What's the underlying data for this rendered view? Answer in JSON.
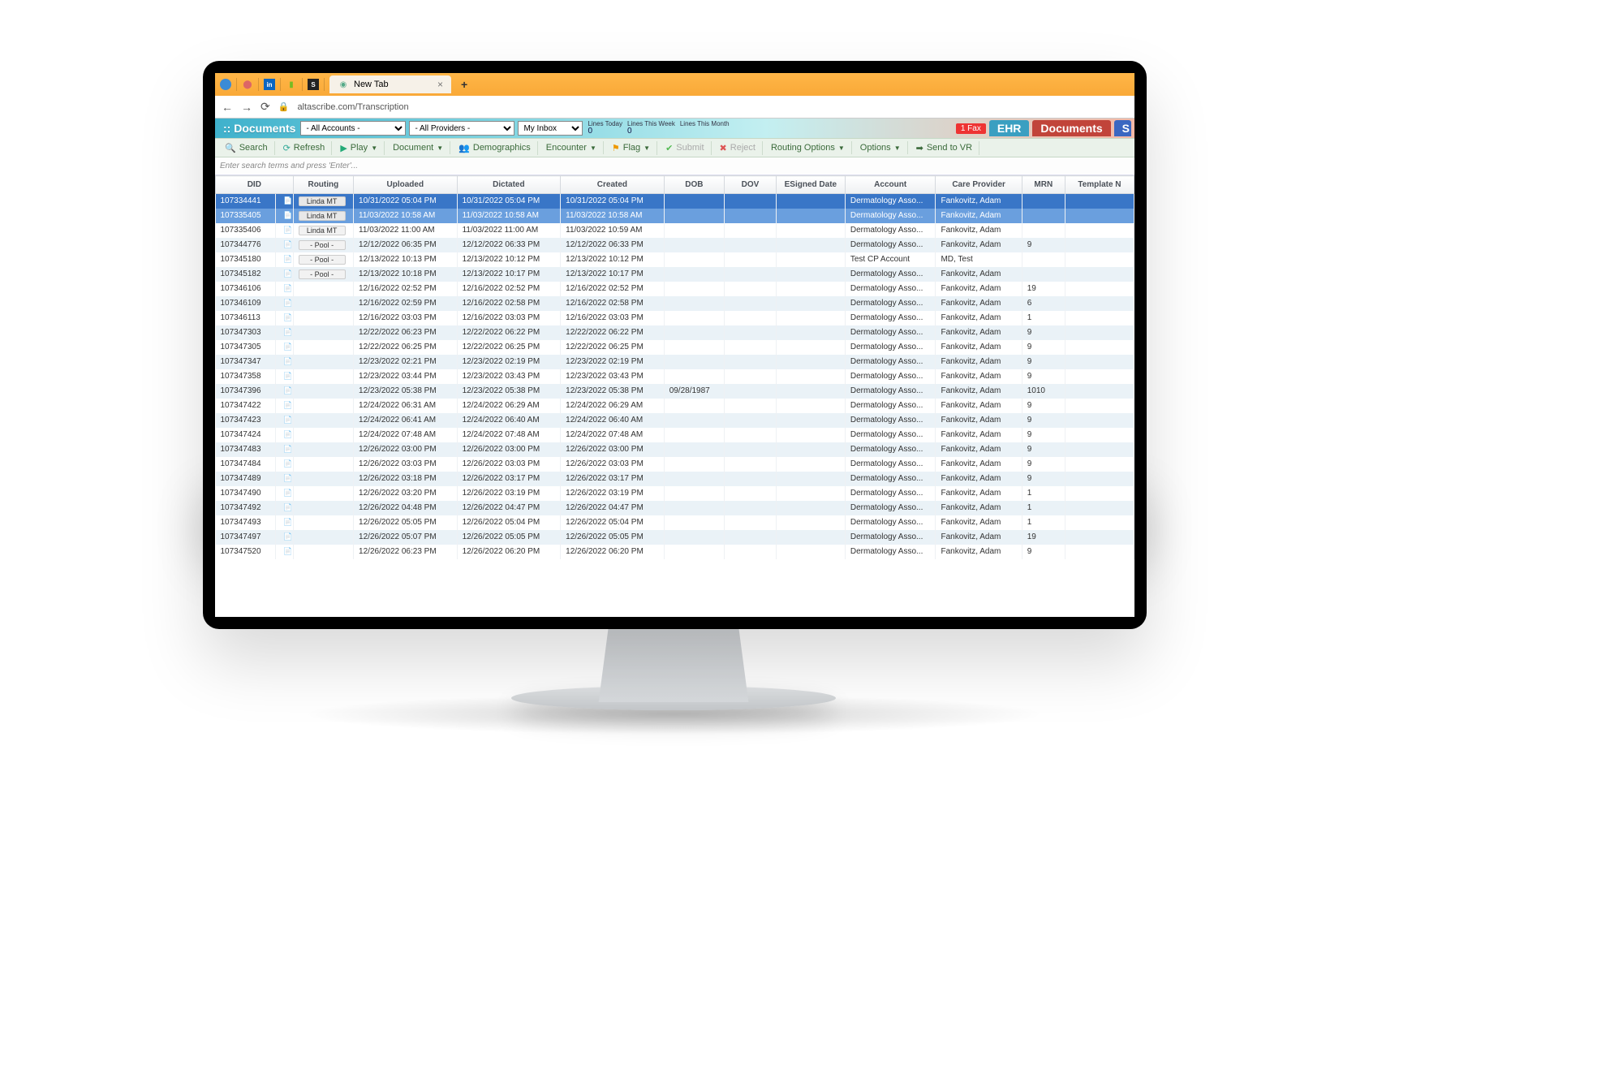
{
  "browser": {
    "tab_label": "New Tab",
    "plus": "+",
    "close": "×",
    "back": "←",
    "forward": "→",
    "reload": "⟳",
    "secure_icon": "🔒",
    "url": "altascribe.com/Transcription"
  },
  "header": {
    "app_title": ":: Documents",
    "accounts_select": "- All Accounts -",
    "providers_select": "- All Providers -",
    "inbox_select": "My Inbox",
    "lines_today_label": "Lines Today",
    "lines_today_value": "0",
    "lines_week_label": "Lines This Week",
    "lines_week_value": "0",
    "lines_month_label": "Lines This Month",
    "lines_month_value": "",
    "fax_badge": "1 Fax",
    "tab_ehr": "EHR",
    "tab_documents": "Documents",
    "tab_s": "S"
  },
  "toolbar": {
    "search": "Search",
    "refresh": "Refresh",
    "play": "Play",
    "document": "Document",
    "demographics": "Demographics",
    "encounter": "Encounter",
    "flag": "Flag",
    "submit": "Submit",
    "reject": "Reject",
    "routing_options": "Routing Options",
    "options": "Options",
    "send_to_vr": "Send to VR",
    "search_placeholder": "Enter search terms and press 'Enter'..."
  },
  "columns": {
    "did": "DID",
    "routing": "Routing",
    "uploaded": "Uploaded",
    "dictated": "Dictated",
    "created": "Created",
    "dob": "DOB",
    "dov": "DOV",
    "esigned": "ESigned Date",
    "account": "Account",
    "care_provider": "Care Provider",
    "mrn": "MRN",
    "template": "Template N"
  },
  "rows": [
    {
      "did": "107334441",
      "routing": "Linda MT",
      "uploaded": "10/31/2022 05:04 PM",
      "dictated": "10/31/2022 05:04 PM",
      "created": "10/31/2022 05:04 PM",
      "dob": "",
      "dov": "",
      "esigned": "",
      "account": "Dermatology Asso...",
      "provider": "Fankovitz, Adam",
      "mrn": "",
      "template": "",
      "sel": "1"
    },
    {
      "did": "107335405",
      "routing": "Linda MT",
      "uploaded": "11/03/2022 10:58 AM",
      "dictated": "11/03/2022 10:58 AM",
      "created": "11/03/2022 10:58 AM",
      "dob": "",
      "dov": "",
      "esigned": "",
      "account": "Dermatology Asso...",
      "provider": "Fankovitz, Adam",
      "mrn": "",
      "template": "",
      "sel": "2"
    },
    {
      "did": "107335406",
      "routing": "Linda MT",
      "uploaded": "11/03/2022 11:00 AM",
      "dictated": "11/03/2022 11:00 AM",
      "created": "11/03/2022 10:59 AM",
      "dob": "",
      "dov": "",
      "esigned": "",
      "account": "Dermatology Asso...",
      "provider": "Fankovitz, Adam",
      "mrn": "",
      "template": ""
    },
    {
      "did": "107344776",
      "routing": "- Pool -",
      "uploaded": "12/12/2022 06:35 PM",
      "dictated": "12/12/2022 06:33 PM",
      "created": "12/12/2022 06:33 PM",
      "dob": "",
      "dov": "",
      "esigned": "",
      "account": "Dermatology Asso...",
      "provider": "Fankovitz, Adam",
      "mrn": "9",
      "template": ""
    },
    {
      "did": "107345180",
      "routing": "- Pool -",
      "uploaded": "12/13/2022 10:13 PM",
      "dictated": "12/13/2022 10:12 PM",
      "created": "12/13/2022 10:12 PM",
      "dob": "",
      "dov": "",
      "esigned": "",
      "account": "Test CP Account",
      "provider": "MD, Test",
      "mrn": "",
      "template": ""
    },
    {
      "did": "107345182",
      "routing": "- Pool -",
      "uploaded": "12/13/2022 10:18 PM",
      "dictated": "12/13/2022 10:17 PM",
      "created": "12/13/2022 10:17 PM",
      "dob": "",
      "dov": "",
      "esigned": "",
      "account": "Dermatology Asso...",
      "provider": "Fankovitz, Adam",
      "mrn": "",
      "template": ""
    },
    {
      "did": "107346106",
      "routing": "",
      "uploaded": "12/16/2022 02:52 PM",
      "dictated": "12/16/2022 02:52 PM",
      "created": "12/16/2022 02:52 PM",
      "dob": "",
      "dov": "",
      "esigned": "",
      "account": "Dermatology Asso...",
      "provider": "Fankovitz, Adam",
      "mrn": "19",
      "template": ""
    },
    {
      "did": "107346109",
      "routing": "",
      "uploaded": "12/16/2022 02:59 PM",
      "dictated": "12/16/2022 02:58 PM",
      "created": "12/16/2022 02:58 PM",
      "dob": "",
      "dov": "",
      "esigned": "",
      "account": "Dermatology Asso...",
      "provider": "Fankovitz, Adam",
      "mrn": "6",
      "template": ""
    },
    {
      "did": "107346113",
      "routing": "",
      "uploaded": "12/16/2022 03:03 PM",
      "dictated": "12/16/2022 03:03 PM",
      "created": "12/16/2022 03:03 PM",
      "dob": "",
      "dov": "",
      "esigned": "",
      "account": "Dermatology Asso...",
      "provider": "Fankovitz, Adam",
      "mrn": "1",
      "template": ""
    },
    {
      "did": "107347303",
      "routing": "",
      "uploaded": "12/22/2022 06:23 PM",
      "dictated": "12/22/2022 06:22 PM",
      "created": "12/22/2022 06:22 PM",
      "dob": "",
      "dov": "",
      "esigned": "",
      "account": "Dermatology Asso...",
      "provider": "Fankovitz, Adam",
      "mrn": "9",
      "template": ""
    },
    {
      "did": "107347305",
      "routing": "",
      "uploaded": "12/22/2022 06:25 PM",
      "dictated": "12/22/2022 06:25 PM",
      "created": "12/22/2022 06:25 PM",
      "dob": "",
      "dov": "",
      "esigned": "",
      "account": "Dermatology Asso...",
      "provider": "Fankovitz, Adam",
      "mrn": "9",
      "template": ""
    },
    {
      "did": "107347347",
      "routing": "",
      "uploaded": "12/23/2022 02:21 PM",
      "dictated": "12/23/2022 02:19 PM",
      "created": "12/23/2022 02:19 PM",
      "dob": "",
      "dov": "",
      "esigned": "",
      "account": "Dermatology Asso...",
      "provider": "Fankovitz, Adam",
      "mrn": "9",
      "template": ""
    },
    {
      "did": "107347358",
      "routing": "",
      "uploaded": "12/23/2022 03:44 PM",
      "dictated": "12/23/2022 03:43 PM",
      "created": "12/23/2022 03:43 PM",
      "dob": "",
      "dov": "",
      "esigned": "",
      "account": "Dermatology Asso...",
      "provider": "Fankovitz, Adam",
      "mrn": "9",
      "template": ""
    },
    {
      "did": "107347396",
      "routing": "",
      "uploaded": "12/23/2022 05:38 PM",
      "dictated": "12/23/2022 05:38 PM",
      "created": "12/23/2022 05:38 PM",
      "dob": "09/28/1987",
      "dov": "",
      "esigned": "",
      "account": "Dermatology Asso...",
      "provider": "Fankovitz, Adam",
      "mrn": "1010",
      "template": ""
    },
    {
      "did": "107347422",
      "routing": "",
      "uploaded": "12/24/2022 06:31 AM",
      "dictated": "12/24/2022 06:29 AM",
      "created": "12/24/2022 06:29 AM",
      "dob": "",
      "dov": "",
      "esigned": "",
      "account": "Dermatology Asso...",
      "provider": "Fankovitz, Adam",
      "mrn": "9",
      "template": ""
    },
    {
      "did": "107347423",
      "routing": "",
      "uploaded": "12/24/2022 06:41 AM",
      "dictated": "12/24/2022 06:40 AM",
      "created": "12/24/2022 06:40 AM",
      "dob": "",
      "dov": "",
      "esigned": "",
      "account": "Dermatology Asso...",
      "provider": "Fankovitz, Adam",
      "mrn": "9",
      "template": ""
    },
    {
      "did": "107347424",
      "routing": "",
      "uploaded": "12/24/2022 07:48 AM",
      "dictated": "12/24/2022 07:48 AM",
      "created": "12/24/2022 07:48 AM",
      "dob": "",
      "dov": "",
      "esigned": "",
      "account": "Dermatology Asso...",
      "provider": "Fankovitz, Adam",
      "mrn": "9",
      "template": ""
    },
    {
      "did": "107347483",
      "routing": "",
      "uploaded": "12/26/2022 03:00 PM",
      "dictated": "12/26/2022 03:00 PM",
      "created": "12/26/2022 03:00 PM",
      "dob": "",
      "dov": "",
      "esigned": "",
      "account": "Dermatology Asso...",
      "provider": "Fankovitz, Adam",
      "mrn": "9",
      "template": ""
    },
    {
      "did": "107347484",
      "routing": "",
      "uploaded": "12/26/2022 03:03 PM",
      "dictated": "12/26/2022 03:03 PM",
      "created": "12/26/2022 03:03 PM",
      "dob": "",
      "dov": "",
      "esigned": "",
      "account": "Dermatology Asso...",
      "provider": "Fankovitz, Adam",
      "mrn": "9",
      "template": ""
    },
    {
      "did": "107347489",
      "routing": "",
      "uploaded": "12/26/2022 03:18 PM",
      "dictated": "12/26/2022 03:17 PM",
      "created": "12/26/2022 03:17 PM",
      "dob": "",
      "dov": "",
      "esigned": "",
      "account": "Dermatology Asso...",
      "provider": "Fankovitz, Adam",
      "mrn": "9",
      "template": ""
    },
    {
      "did": "107347490",
      "routing": "",
      "uploaded": "12/26/2022 03:20 PM",
      "dictated": "12/26/2022 03:19 PM",
      "created": "12/26/2022 03:19 PM",
      "dob": "",
      "dov": "",
      "esigned": "",
      "account": "Dermatology Asso...",
      "provider": "Fankovitz, Adam",
      "mrn": "1",
      "template": ""
    },
    {
      "did": "107347492",
      "routing": "",
      "uploaded": "12/26/2022 04:48 PM",
      "dictated": "12/26/2022 04:47 PM",
      "created": "12/26/2022 04:47 PM",
      "dob": "",
      "dov": "",
      "esigned": "",
      "account": "Dermatology Asso...",
      "provider": "Fankovitz, Adam",
      "mrn": "1",
      "template": ""
    },
    {
      "did": "107347493",
      "routing": "",
      "uploaded": "12/26/2022 05:05 PM",
      "dictated": "12/26/2022 05:04 PM",
      "created": "12/26/2022 05:04 PM",
      "dob": "",
      "dov": "",
      "esigned": "",
      "account": "Dermatology Asso...",
      "provider": "Fankovitz, Adam",
      "mrn": "1",
      "template": ""
    },
    {
      "did": "107347497",
      "routing": "",
      "uploaded": "12/26/2022 05:07 PM",
      "dictated": "12/26/2022 05:05 PM",
      "created": "12/26/2022 05:05 PM",
      "dob": "",
      "dov": "",
      "esigned": "",
      "account": "Dermatology Asso...",
      "provider": "Fankovitz, Adam",
      "mrn": "19",
      "template": ""
    },
    {
      "did": "107347520",
      "routing": "",
      "uploaded": "12/26/2022 06:23 PM",
      "dictated": "12/26/2022 06:20 PM",
      "created": "12/26/2022 06:20 PM",
      "dob": "",
      "dov": "",
      "esigned": "",
      "account": "Dermatology Asso...",
      "provider": "Fankovitz, Adam",
      "mrn": "9",
      "template": ""
    }
  ]
}
